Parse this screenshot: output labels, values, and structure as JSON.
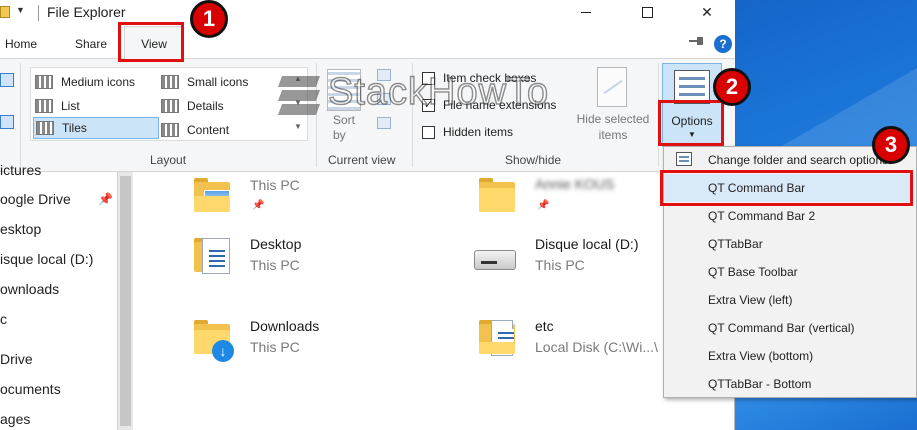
{
  "window": {
    "title": "File Explorer"
  },
  "tabs": {
    "home": "Home",
    "share": "Share",
    "view": "View"
  },
  "ribbon": {
    "layout": {
      "label": "Layout",
      "items": [
        "Medium icons",
        "Small icons",
        "List",
        "Details",
        "Tiles",
        "Content"
      ],
      "selected": "Tiles"
    },
    "current_view": {
      "label": "Current view",
      "sort_by": "Sort\nby"
    },
    "show_hide": {
      "label": "Show/hide",
      "item_check_boxes": "Item check boxes",
      "file_name_extensions": "File name extensions",
      "hidden_items": "Hidden items",
      "hide_selected": "Hide selected\nitems",
      "checkmark": "✓"
    },
    "options": {
      "label": "Options"
    }
  },
  "nav_pane": {
    "items": [
      "ictures",
      "oogle Drive",
      "esktop",
      "isque local (D:)",
      "ownloads",
      "c",
      "Drive",
      "ocuments",
      "ages"
    ]
  },
  "content": {
    "items": [
      {
        "name": "",
        "sub": "This PC"
      },
      {
        "name": "Annie KOUS",
        "sub": ""
      },
      {
        "name": "Desktop",
        "sub": "This PC"
      },
      {
        "name": "Disque local (D:)",
        "sub": "This PC"
      },
      {
        "name": "Downloads",
        "sub": "This PC"
      },
      {
        "name": "etc",
        "sub": "Local Disk (C:\\Wi...\\"
      }
    ]
  },
  "options_menu": {
    "items": [
      "Change folder and search options",
      "QT Command Bar",
      "QT Command Bar 2",
      "QTTabBar",
      "QT Base Toolbar",
      "Extra View (left)",
      "QT Command Bar (vertical)",
      "Extra View (bottom)",
      "QTTabBar - Bottom"
    ]
  },
  "annotations": {
    "step1": "1",
    "step2": "2",
    "step3": "3"
  },
  "watermark": {
    "text": "StackHowTo"
  },
  "colors": {
    "accent": "#1a6fd0",
    "highlight": "#cce4f7",
    "annotation_red": "#e01010"
  }
}
